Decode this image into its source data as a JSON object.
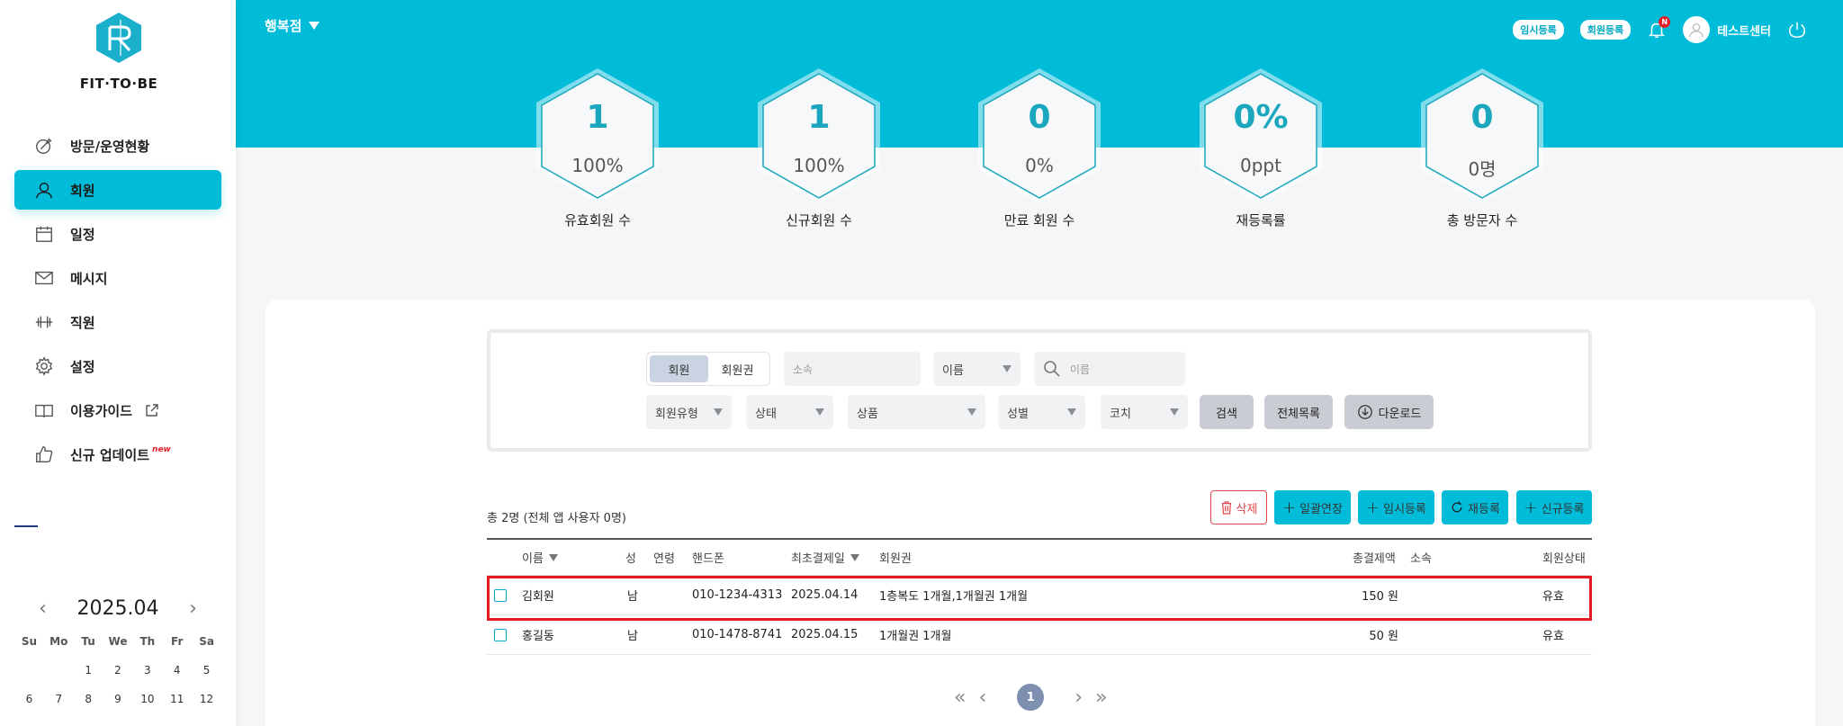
{
  "brand": {
    "logo_text": "FIT·TO·BE"
  },
  "sidebar": {
    "items": [
      {
        "label": "방문/운영현황",
        "icon": "compass-icon",
        "active": false
      },
      {
        "label": "회원",
        "icon": "user-icon",
        "active": true
      },
      {
        "label": "일정",
        "icon": "calendar-icon",
        "active": false
      },
      {
        "label": "메시지",
        "icon": "mail-icon",
        "active": false
      },
      {
        "label": "직원",
        "icon": "dumbbell-icon",
        "active": false
      },
      {
        "label": "설정",
        "icon": "gear-icon",
        "active": false
      },
      {
        "label": "이용가이드",
        "icon": "book-icon",
        "active": false
      },
      {
        "label": "신규 업데이트",
        "icon": "thumbs-up-icon",
        "active": false,
        "badge": "new"
      }
    ]
  },
  "calendar": {
    "month": "2025.04",
    "weekdays": [
      "Su",
      "Mo",
      "Tu",
      "We",
      "Th",
      "Fr",
      "Sa"
    ],
    "days": [
      "",
      "",
      "1",
      "2",
      "3",
      "4",
      "5",
      "6",
      "7",
      "8",
      "9",
      "10",
      "11",
      "12"
    ]
  },
  "header": {
    "store": "행복점",
    "temp_register": "임시등록",
    "member_register": "회원등록",
    "notification_badge": "N",
    "user_name": "테스트센터"
  },
  "kpis": [
    {
      "value": "1",
      "sub": "100%",
      "label": "유효회원 수"
    },
    {
      "value": "1",
      "sub": "100%",
      "label": "신규회원 수"
    },
    {
      "value": "0",
      "sub": "0%",
      "label": "만료 회원 수"
    },
    {
      "value": "0%",
      "sub": "0ppt",
      "label": "재등록률"
    },
    {
      "value": "0",
      "sub": "0명",
      "label": "총 방문자 수"
    }
  ],
  "filter": {
    "seg_member": "회원",
    "seg_pass": "회원권",
    "affiliation_placeholder": "소속",
    "name_select": "이름",
    "search_placeholder": "이름",
    "member_type": "회원유형",
    "status": "상태",
    "product": "상품",
    "gender": "성별",
    "coach": "코치",
    "search_btn": "검색",
    "all_list_btn": "전체목록",
    "download_btn": "다운로드"
  },
  "list": {
    "total_text": "총 2명 (전체 앱 사용자 0명)",
    "delete_btn": "삭제",
    "bulk_extend_btn": "일괄연장",
    "temp_register_btn": "임시등록",
    "re_register_btn": "재등록",
    "new_register_btn": "신규등록",
    "columns": {
      "name": "이름",
      "gender": "성",
      "age": "연령",
      "phone": "핸드폰",
      "first_pay": "최초결제일",
      "pass": "회원권",
      "total_pay": "총결제액",
      "affiliation": "소속",
      "status": "회원상태"
    },
    "rows": [
      {
        "name": "김회원",
        "gender": "남",
        "age": "",
        "phone": "010-1234-4313",
        "first_pay": "2025.04.14",
        "pass": "1층복도 1개월,1개월권 1개월",
        "total_pay": "150 원",
        "affiliation": "",
        "status": "유효"
      },
      {
        "name": "홍길동",
        "gender": "남",
        "age": "",
        "phone": "010-1478-8741",
        "first_pay": "2025.04.15",
        "pass": "1개월권 1개월",
        "total_pay": "50 원",
        "affiliation": "",
        "status": "유효"
      }
    ]
  },
  "pager": {
    "current": "1"
  },
  "colors": {
    "accent": "#00bcd8",
    "highlight": "#e21b23",
    "pager": "#7e8fb0"
  }
}
